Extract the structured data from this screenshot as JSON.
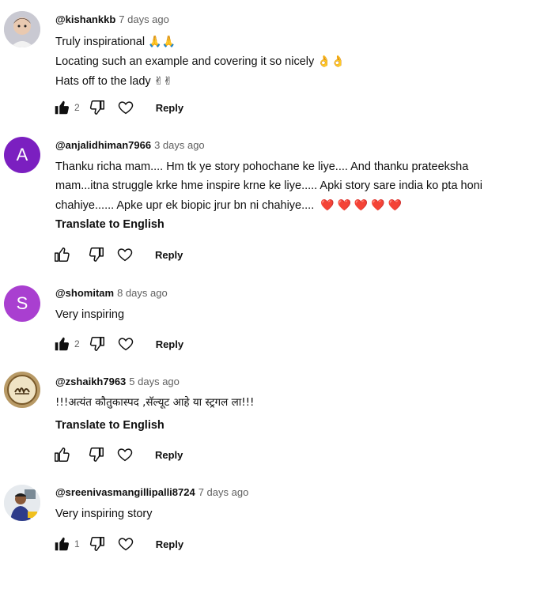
{
  "comments": [
    {
      "handle": "@kishankkb",
      "time": "7 days ago",
      "avatar": "child-photo-avatar",
      "lines": [
        "Truly inspirational",
        "Locating such an example and covering it so nicely",
        "Hats off to the lady"
      ],
      "emojis": [
        "🙏🙏",
        "👌👌",
        "✌✌"
      ],
      "likes": "2",
      "liked": true,
      "reply_label": "Reply"
    },
    {
      "handle": "@anjalidhiman7966",
      "time": "3 days ago",
      "avatar_letter": "A",
      "avatar_color": "#7b1fc0",
      "lines": [
        "Thanku richa mam.... Hm tk ye story pohochane ke liye.... And thanku prateeksha",
        "mam...itna struggle krke hme inspire krne ke liye..... Apki story sare india ko pta honi",
        "chahiye...... Apke upr ek biopic jrur bn ni chahiye...."
      ],
      "emojis": [
        "",
        "",
        "❤️ ❤️ ❤️ ❤️ ❤️"
      ],
      "translate_label": "Translate to English",
      "likes": "",
      "liked": false,
      "reply_label": "Reply"
    },
    {
      "handle": "@shomitam",
      "time": "8 days ago",
      "avatar_letter": "S",
      "avatar_color": "#a93fd0",
      "lines": [
        "Very inspiring"
      ],
      "likes": "2",
      "liked": true,
      "reply_label": "Reply"
    },
    {
      "handle": "@zshaikh7963",
      "time": "5 days ago",
      "avatar": "calligraphy-avatar",
      "lines": [
        "!!!अत्यंत कौतुकास्पद ,सॅल्यूट आहे या स्ट्रगल ला!!!"
      ],
      "translate_label": "Translate to English",
      "likes": "",
      "liked": false,
      "reply_label": "Reply"
    },
    {
      "handle": "@sreenivasmangillipalli8724",
      "time": "7 days ago",
      "avatar": "person-photo-avatar",
      "lines": [
        "Very inspiring story"
      ],
      "likes": "1",
      "liked": true,
      "reply_label": "Reply"
    }
  ]
}
